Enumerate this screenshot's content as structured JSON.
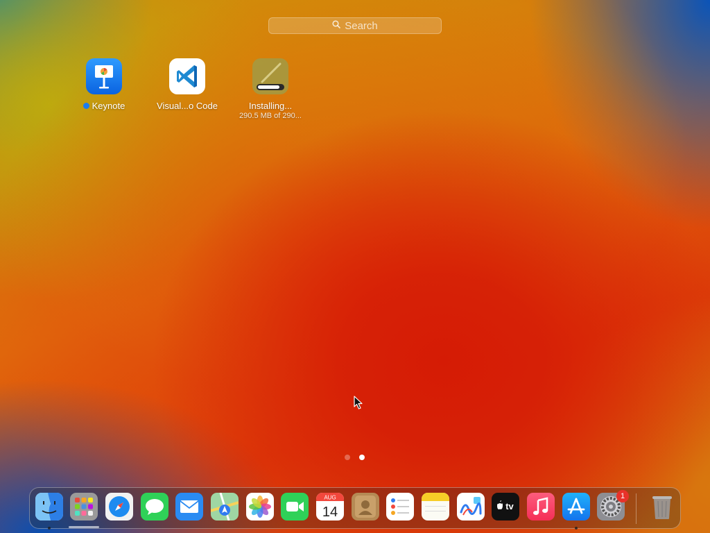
{
  "search": {
    "placeholder": "Search",
    "icon": "search-icon"
  },
  "launchpad_apps": [
    {
      "name": "Keynote",
      "is_new": true,
      "icon": "keynote-icon"
    },
    {
      "name": "Visual...o Code",
      "icon": "vscode-icon"
    },
    {
      "name": "Installing...",
      "subtitle": "290.5 MB of 290...",
      "icon": "installing-app-icon",
      "progress": 0.85
    }
  ],
  "pager": {
    "pages": 2,
    "current": 2
  },
  "dock": {
    "items": [
      "Finder",
      "Launchpad",
      "Safari",
      "Messages",
      "Mail",
      "Maps",
      "Photos",
      "FaceTime",
      "Calendar",
      "Contacts",
      "Reminders",
      "Notes",
      "Freeform",
      "TV",
      "Music",
      "App Store",
      "System Settings",
      "Trash"
    ],
    "calendar": {
      "month": "AUG",
      "day": "14"
    },
    "tv_label": "tv",
    "settings_badge": "1",
    "running": [
      "Finder",
      "App Store"
    ]
  },
  "colors": {
    "accent": "#1a7cf0",
    "badge": "#e8322a",
    "wallpaper_red": "#d51b05",
    "wallpaper_yellow": "#d59c08",
    "wallpaper_blue": "#0b54b8"
  }
}
